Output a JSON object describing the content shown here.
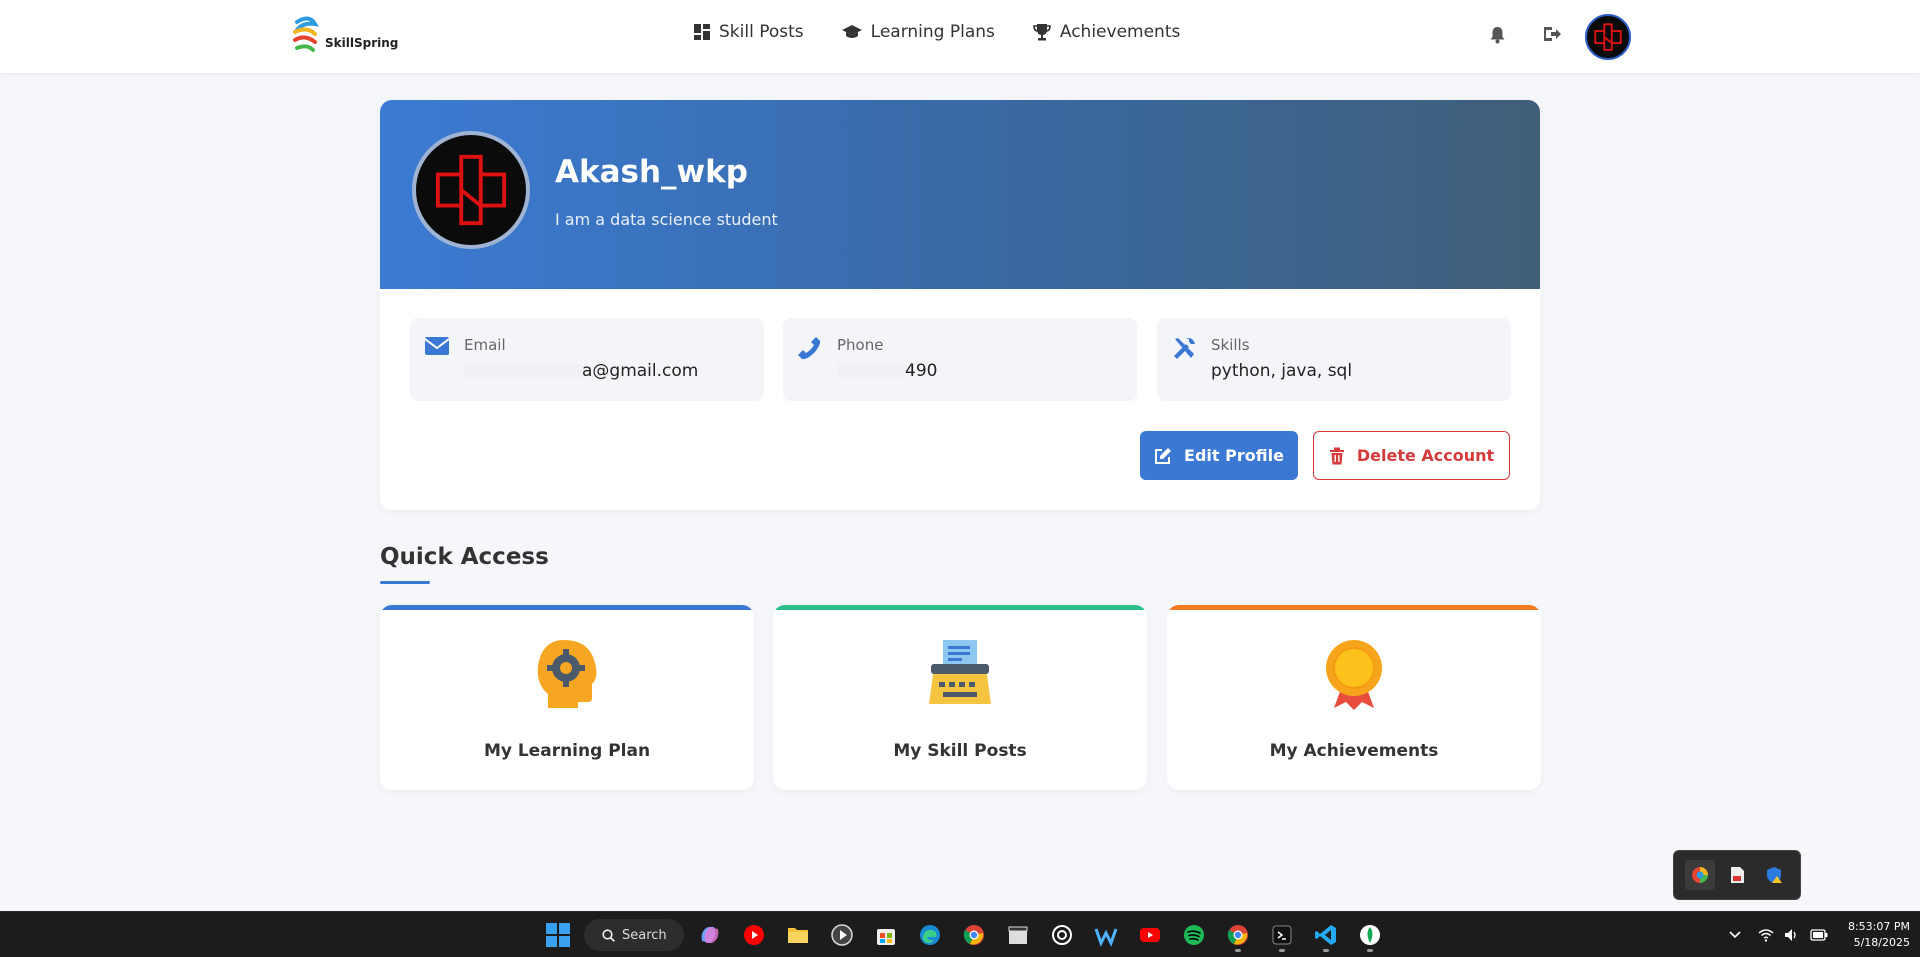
{
  "app": {
    "logo_text": "SkillSpring"
  },
  "nav": {
    "links": [
      {
        "label": "Skill Posts",
        "icon": "dashboard-icon"
      },
      {
        "label": "Learning Plans",
        "icon": "graduation-cap-icon"
      },
      {
        "label": "Achievements",
        "icon": "trophy-icon"
      }
    ]
  },
  "profile": {
    "username": "Akash_wkp",
    "bio": "I am a data science student",
    "email": {
      "label": "Email",
      "value": "a@gmail.com"
    },
    "phone": {
      "label": "Phone",
      "value": "490"
    },
    "skills": {
      "label": "Skills",
      "value": "python, java, sql"
    },
    "edit_label": "Edit Profile",
    "delete_label": "Delete Account"
  },
  "quick_access": {
    "title": "Quick Access",
    "cards": [
      {
        "label": "My Learning Plan",
        "accent": "#3a78d3",
        "icon": "head-gear-icon"
      },
      {
        "label": "My Skill Posts",
        "accent": "#2bbf8a",
        "icon": "typewriter-icon"
      },
      {
        "label": "My Achievements",
        "accent": "#f47a22",
        "icon": "medal-icon"
      }
    ]
  },
  "taskbar": {
    "search_label": "Search",
    "time": "8:53:07 PM",
    "date": "5/18/2025"
  },
  "colors": {
    "primary": "#3a78d3",
    "danger": "#d63a3a",
    "banner_start": "#3b7bd4",
    "banner_end": "#3e5f78"
  }
}
